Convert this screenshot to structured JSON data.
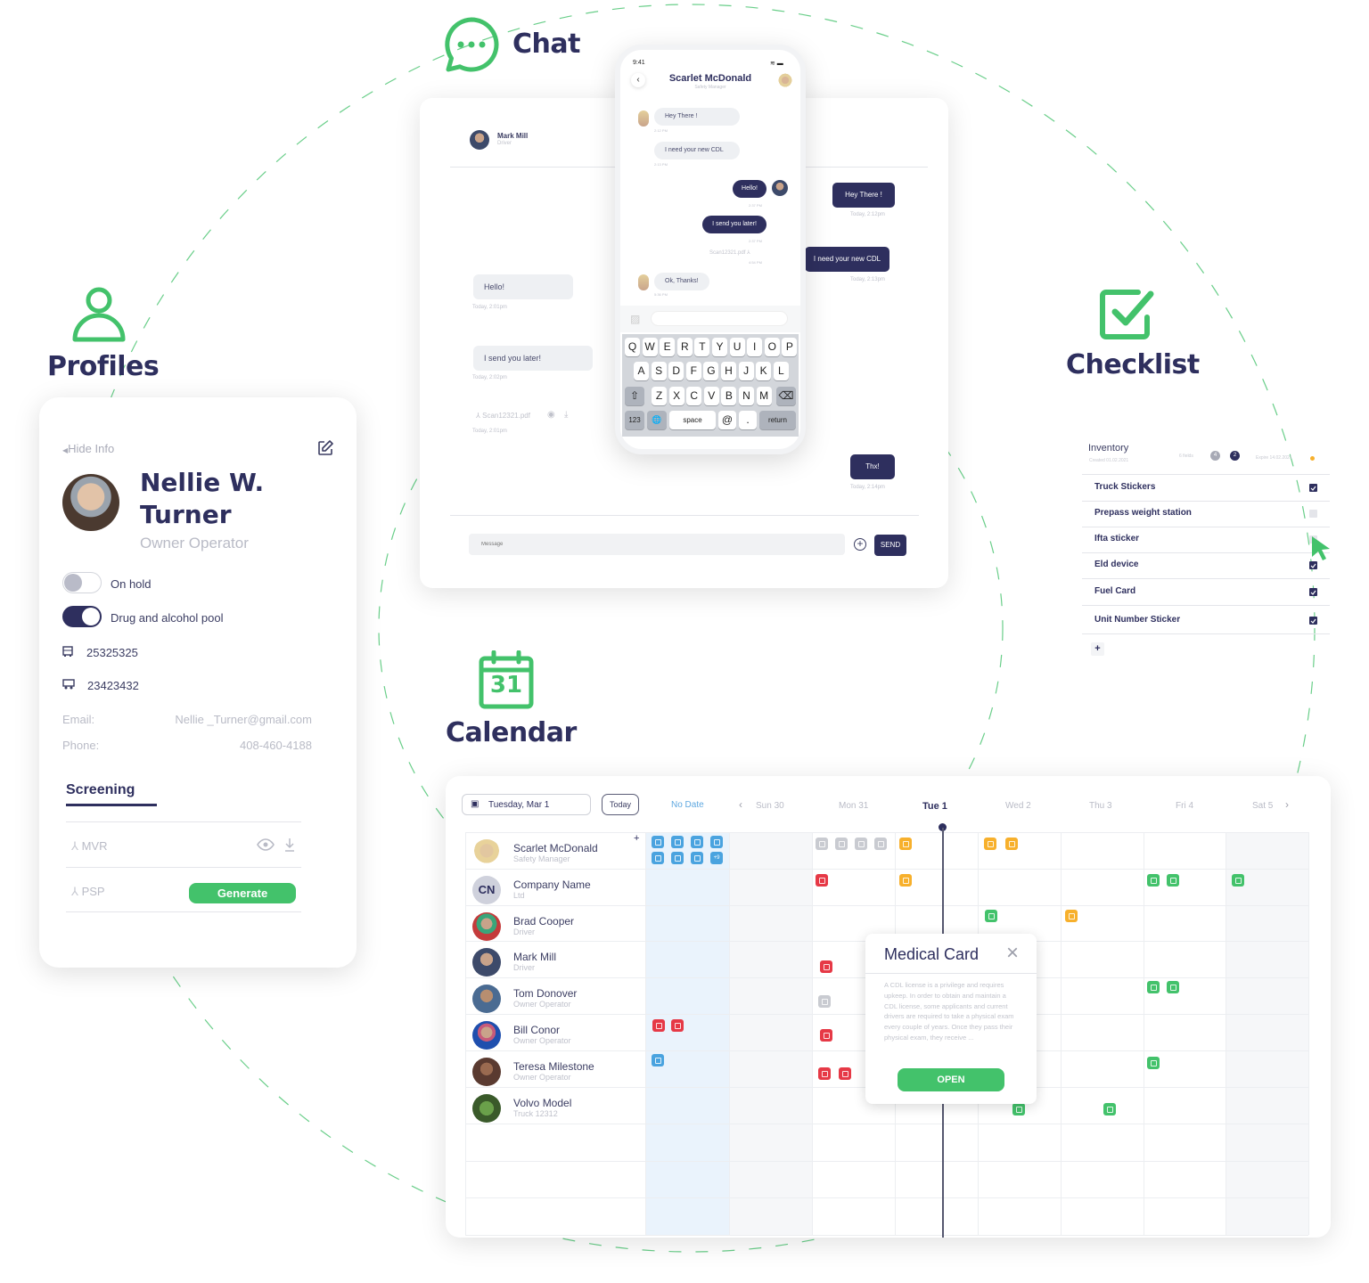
{
  "features": {
    "chat": "Chat",
    "profiles": "Profiles",
    "checklist": "Checklist",
    "calendar": "Calendar",
    "calendar_icon_day": "31"
  },
  "profile": {
    "hide_info": "Hide Info",
    "name_line1": "Nellie W.",
    "name_line2": "Turner",
    "role": "Owner Operator",
    "toggles": [
      {
        "label": "On hold",
        "on": false
      },
      {
        "label": "Drug and alcohol pool",
        "on": true
      }
    ],
    "truck_number": "25325325",
    "trailer_number": "23423432",
    "email_label": "Email:",
    "email": "Nellie _Turner@gmail.com",
    "phone_label": "Phone:",
    "phone": "408-460-4188",
    "tab": "Screening",
    "documents": [
      {
        "name": "MVR"
      },
      {
        "name": "PSP",
        "action": "Generate"
      }
    ]
  },
  "chat_window": {
    "contact_name": "Mark Mill",
    "contact_role": "Driver",
    "incoming": [
      {
        "text": "Hello!",
        "time": "Today, 2:01pm"
      },
      {
        "text": "I send you later!",
        "time": "Today, 2:02pm"
      }
    ],
    "file": {
      "name": "Scan12321.pdf",
      "time": "Today, 2:01pm"
    },
    "outgoing": [
      {
        "text": "Hey There !",
        "time": "Today, 2:12pm"
      },
      {
        "text": "I need your new CDL",
        "time": "Today, 2:13pm"
      },
      {
        "text": "Thx!",
        "time": "Today, 2:14pm"
      }
    ],
    "message_placeholder": "Message",
    "send_label": "SEND"
  },
  "phone": {
    "clock": "9:41",
    "contact_name": "Scarlet McDonald",
    "contact_role": "Safety Manager",
    "messages": [
      {
        "dir": "in",
        "text": "Hey There !",
        "time": "2:12 PM"
      },
      {
        "dir": "in",
        "text": "I need your new CDL",
        "time": "2:13 PM"
      },
      {
        "dir": "out",
        "text": "Hello!",
        "time": "2:37 PM"
      },
      {
        "dir": "out",
        "text": "I send you later!",
        "time": "2:37 PM"
      },
      {
        "dir": "file",
        "text": "Scan12321.pdf",
        "time": "4:54 PM"
      },
      {
        "dir": "in",
        "text": "Ok, Thanks!",
        "time": "5:36 PM"
      }
    ],
    "keyboard": {
      "row1": [
        "Q",
        "W",
        "E",
        "R",
        "T",
        "Y",
        "U",
        "I",
        "O",
        "P"
      ],
      "row2": [
        "A",
        "S",
        "D",
        "F",
        "G",
        "H",
        "J",
        "K",
        "L"
      ],
      "row3": [
        "Z",
        "X",
        "C",
        "V",
        "B",
        "N",
        "M"
      ],
      "numbers": "123",
      "space": "space",
      "at": "@",
      "dot": ".",
      "return": "return"
    }
  },
  "checklist": {
    "title": "Inventory",
    "created": "Created 01.02.2021",
    "fields": "6 fields",
    "badge_gray": "4",
    "badge_dark": "2",
    "expire": "Expire 14.02.2021",
    "items": [
      {
        "label": "Truck Stickers",
        "checked": true
      },
      {
        "label": "Prepass weight station",
        "checked": false
      },
      {
        "label": "Ifta sticker",
        "checked": false
      },
      {
        "label": "Eld device",
        "checked": true
      },
      {
        "label": "Fuel Card",
        "checked": true
      },
      {
        "label": "Unit Number Sticker",
        "checked": true
      }
    ],
    "add_label": "+"
  },
  "calendar": {
    "date_value": "Tuesday, Mar 1",
    "today_label": "Today",
    "no_date_label": "No Date",
    "days": [
      "Sun 30",
      "Mon 31",
      "Tue 1",
      "Wed 2",
      "Thu 3",
      "Fri 4",
      "Sat 5"
    ],
    "current_day": "Tue 1",
    "add_label": "+",
    "more_label": "+9",
    "rows": [
      {
        "name": "Scarlet McDonald",
        "role": "Safety Manager"
      },
      {
        "name": "Company Name",
        "role": "Ltd",
        "initials": "CN"
      },
      {
        "name": "Brad Cooper",
        "role": "Driver"
      },
      {
        "name": "Mark Mill",
        "role": "Driver"
      },
      {
        "name": "Tom Donover",
        "role": "Owner Operator"
      },
      {
        "name": "Bill Conor",
        "role": "Owner Operator"
      },
      {
        "name": "Teresa Milestone",
        "role": "Owner Operator"
      },
      {
        "name": "Volvo Model",
        "role": "Truck 12312"
      }
    ],
    "popup": {
      "title": "Medical Card",
      "body": "A CDL license is a privilege and requires upkeep. In order to obtain and maintain a CDL license, some applicants and current drivers are required to take a physical exam every couple of years. Once they pass their physical exam, they receive ...",
      "action": "OPEN"
    }
  },
  "colors": {
    "accent_green": "#43c26b",
    "navy": "#2e2f5e",
    "event_blue": "#4aa3df",
    "event_red": "#e63946",
    "event_orange": "#f7b02c",
    "event_green": "#43c26b",
    "event_gray": "#c9cbd1"
  }
}
